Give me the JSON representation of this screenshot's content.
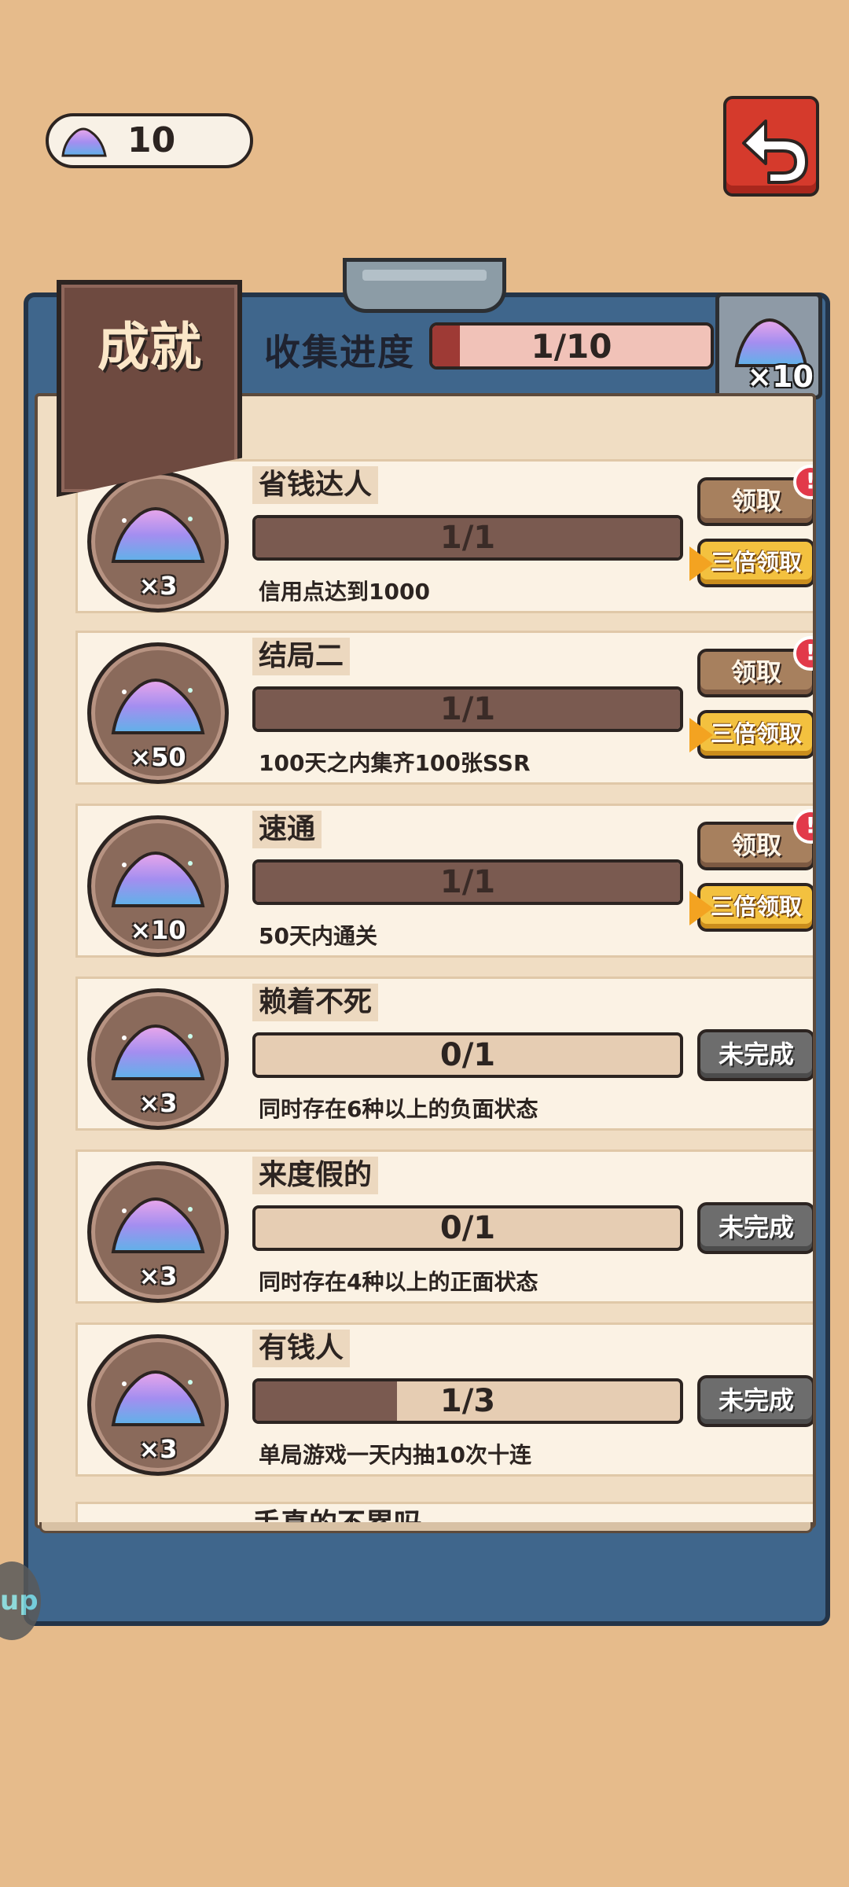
{
  "currency": {
    "icon": "gem-icon",
    "value": "10"
  },
  "panel": {
    "title": "成就",
    "collect_label": "收集进度",
    "collect_progress_text": "1/10",
    "collect_progress_fraction": 0.1,
    "reward_count": "×10"
  },
  "achievements": [
    {
      "title": "省钱达人",
      "progress": "1/1",
      "fraction": 1,
      "desc": "信用点达到1000",
      "reward": "×3",
      "state": "claim",
      "claim_label": "领取",
      "triple_label": "三倍领取"
    },
    {
      "title": "结局二",
      "progress": "1/1",
      "fraction": 1,
      "desc": "100天之内集齐100张SSR",
      "reward": "×50",
      "state": "claim",
      "claim_label": "领取",
      "triple_label": "三倍领取"
    },
    {
      "title": "速通",
      "progress": "1/1",
      "fraction": 1,
      "desc": "50天内通关",
      "reward": "×10",
      "state": "claim",
      "claim_label": "领取",
      "triple_label": "三倍领取"
    },
    {
      "title": "赖着不死",
      "progress": "0/1",
      "fraction": 0,
      "desc": "同时存在6种以上的负面状态",
      "reward": "×3",
      "state": "undone",
      "undone_label": "未完成"
    },
    {
      "title": "来度假的",
      "progress": "0/1",
      "fraction": 0,
      "desc": "同时存在4种以上的正面状态",
      "reward": "×3",
      "state": "undone",
      "undone_label": "未完成"
    },
    {
      "title": "有钱人",
      "progress": "1/3",
      "fraction": 0.333,
      "desc": "单局游戏一天内抽10次十连",
      "reward": "×3",
      "state": "undone",
      "undone_label": "未完成"
    }
  ],
  "partial_title": "手真的不累吗",
  "alert_mark": "!",
  "side_bubble_text": "up",
  "colors": {
    "background": "#e6bb8b",
    "board": "#3f668c",
    "paper": "#f0ddc3",
    "accent_red": "#d53a2c",
    "gold": "#f3c13f"
  }
}
